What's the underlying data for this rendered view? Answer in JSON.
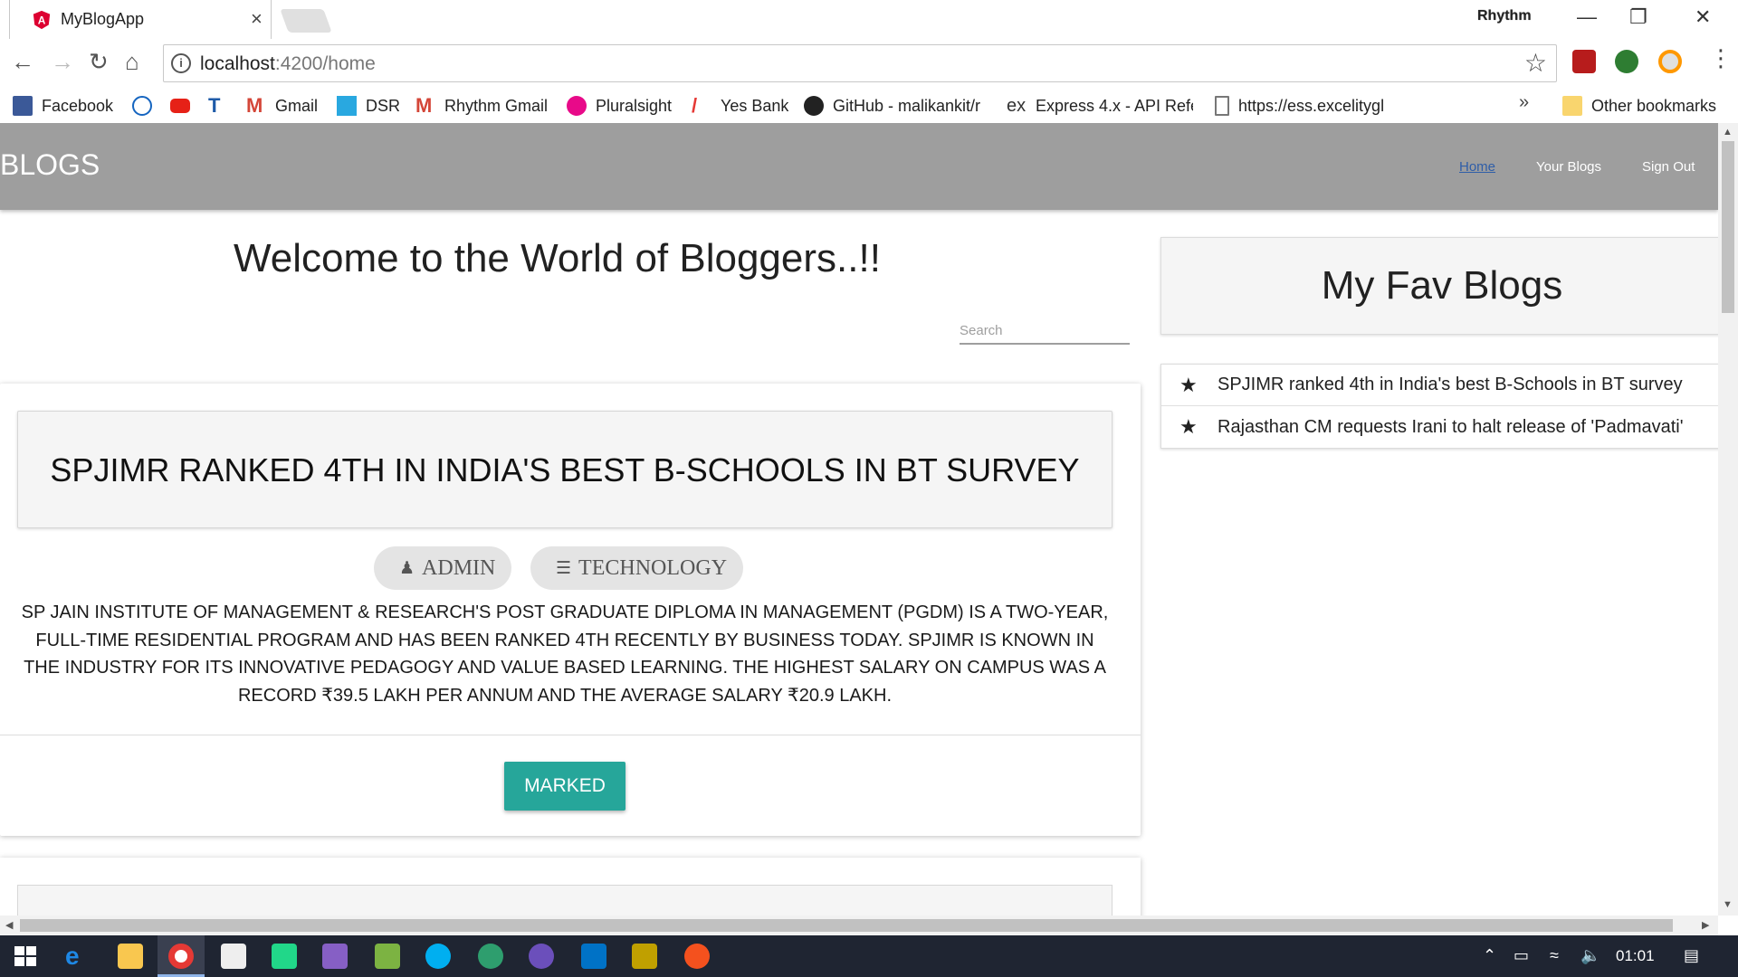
{
  "browser": {
    "tab_title": "MyBlogApp",
    "tab_close": "×",
    "profile_name": "Rhythm",
    "url_host": "localhost",
    "url_rest": ":4200/home",
    "bookmarks": [
      {
        "label": "Facebook",
        "icon": "facebook-icon",
        "color": "#3b5998"
      },
      {
        "label": "",
        "icon": "circle-logo-icon",
        "color": "#1565c0"
      },
      {
        "label": "",
        "icon": "youtube-icon",
        "color": "#e62117"
      },
      {
        "label": "",
        "icon": "tz-icon",
        "color": "#1e5aa8"
      },
      {
        "label": "Gmail",
        "icon": "gmail-icon",
        "color": "#d44638"
      },
      {
        "label": "DSR",
        "icon": "dsr-icon",
        "color": "#29a8e0"
      },
      {
        "label": "Rhythm Gmail",
        "icon": "gmail-icon",
        "color": "#d44638"
      },
      {
        "label": "Pluralsight",
        "icon": "pluralsight-icon",
        "color": "#e80a89"
      },
      {
        "label": "Yes Bank",
        "icon": "yesbank-icon",
        "color": "#e53935"
      },
      {
        "label": "GitHub - malikankit/r",
        "icon": "github-icon",
        "color": "#222222"
      },
      {
        "label": "Express 4.x - API Refe",
        "icon": "express-icon",
        "color": "#333333"
      },
      {
        "label": "https://ess.excelitygl",
        "icon": "page-icon",
        "color": "#777777"
      }
    ],
    "bookmarks_more": "»",
    "other_bookmarks": "Other bookmarks"
  },
  "navbar": {
    "brand": "BLOGS",
    "links": [
      "Home",
      "Your Blogs",
      "Sign Out"
    ]
  },
  "main": {
    "welcome": "Welcome to the World of Bloggers..!!",
    "search_placeholder": "Search",
    "post": {
      "title": "SPJIMR RANKED 4TH IN INDIA'S BEST B-SCHOOLS IN BT SURVEY",
      "author": "ADMIN",
      "category": "TECHNOLOGY",
      "body": "SP JAIN INSTITUTE OF MANAGEMENT & RESEARCH'S POST GRADUATE DIPLOMA IN MANAGEMENT (PGDM) IS A TWO-YEAR, FULL-TIME RESIDENTIAL PROGRAM AND HAS BEEN RANKED 4TH RECENTLY BY BUSINESS TODAY. SPJIMR IS KNOWN IN THE INDUSTRY FOR ITS INNOVATIVE PEDAGOGY AND VALUE BASED LEARNING. THE HIGHEST SALARY ON CAMPUS WAS A RECORD ₹39.5 LAKH PER ANNUM AND THE AVERAGE SALARY ₹20.9 LAKH.",
      "button": "MARKED",
      "button_color": "#26a69a"
    }
  },
  "sidebar": {
    "title": "My Fav Blogs",
    "items": [
      "SPJIMR ranked 4th in India's best B-Schools in BT survey",
      "Rajasthan CM requests Irani to halt release of 'Padmavati'"
    ]
  },
  "taskbar": {
    "time": "01:01"
  },
  "colors": {
    "navbar": "#9e9e9e",
    "accent": "#26a69a"
  }
}
